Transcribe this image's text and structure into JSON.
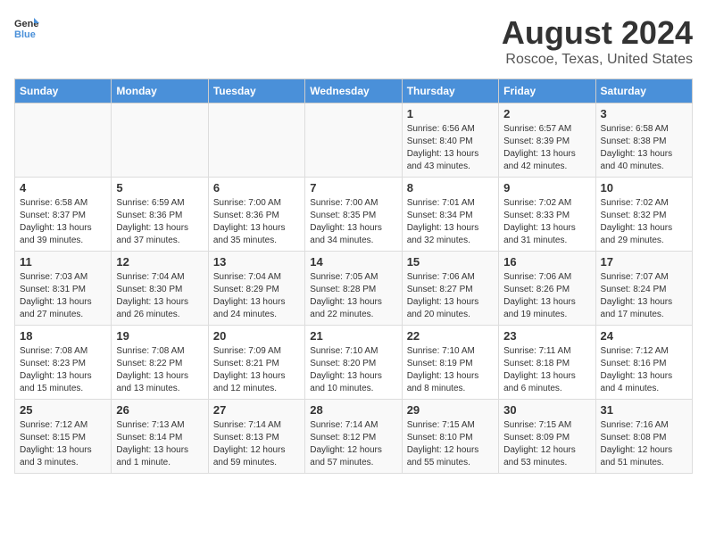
{
  "header": {
    "logo_general": "General",
    "logo_blue": "Blue",
    "title": "August 2024",
    "subtitle": "Roscoe, Texas, United States"
  },
  "days_of_week": [
    "Sunday",
    "Monday",
    "Tuesday",
    "Wednesday",
    "Thursday",
    "Friday",
    "Saturday"
  ],
  "weeks": [
    [
      {
        "day": "",
        "info": ""
      },
      {
        "day": "",
        "info": ""
      },
      {
        "day": "",
        "info": ""
      },
      {
        "day": "",
        "info": ""
      },
      {
        "day": "1",
        "info": "Sunrise: 6:56 AM\nSunset: 8:40 PM\nDaylight: 13 hours\nand 43 minutes."
      },
      {
        "day": "2",
        "info": "Sunrise: 6:57 AM\nSunset: 8:39 PM\nDaylight: 13 hours\nand 42 minutes."
      },
      {
        "day": "3",
        "info": "Sunrise: 6:58 AM\nSunset: 8:38 PM\nDaylight: 13 hours\nand 40 minutes."
      }
    ],
    [
      {
        "day": "4",
        "info": "Sunrise: 6:58 AM\nSunset: 8:37 PM\nDaylight: 13 hours\nand 39 minutes."
      },
      {
        "day": "5",
        "info": "Sunrise: 6:59 AM\nSunset: 8:36 PM\nDaylight: 13 hours\nand 37 minutes."
      },
      {
        "day": "6",
        "info": "Sunrise: 7:00 AM\nSunset: 8:36 PM\nDaylight: 13 hours\nand 35 minutes."
      },
      {
        "day": "7",
        "info": "Sunrise: 7:00 AM\nSunset: 8:35 PM\nDaylight: 13 hours\nand 34 minutes."
      },
      {
        "day": "8",
        "info": "Sunrise: 7:01 AM\nSunset: 8:34 PM\nDaylight: 13 hours\nand 32 minutes."
      },
      {
        "day": "9",
        "info": "Sunrise: 7:02 AM\nSunset: 8:33 PM\nDaylight: 13 hours\nand 31 minutes."
      },
      {
        "day": "10",
        "info": "Sunrise: 7:02 AM\nSunset: 8:32 PM\nDaylight: 13 hours\nand 29 minutes."
      }
    ],
    [
      {
        "day": "11",
        "info": "Sunrise: 7:03 AM\nSunset: 8:31 PM\nDaylight: 13 hours\nand 27 minutes."
      },
      {
        "day": "12",
        "info": "Sunrise: 7:04 AM\nSunset: 8:30 PM\nDaylight: 13 hours\nand 26 minutes."
      },
      {
        "day": "13",
        "info": "Sunrise: 7:04 AM\nSunset: 8:29 PM\nDaylight: 13 hours\nand 24 minutes."
      },
      {
        "day": "14",
        "info": "Sunrise: 7:05 AM\nSunset: 8:28 PM\nDaylight: 13 hours\nand 22 minutes."
      },
      {
        "day": "15",
        "info": "Sunrise: 7:06 AM\nSunset: 8:27 PM\nDaylight: 13 hours\nand 20 minutes."
      },
      {
        "day": "16",
        "info": "Sunrise: 7:06 AM\nSunset: 8:26 PM\nDaylight: 13 hours\nand 19 minutes."
      },
      {
        "day": "17",
        "info": "Sunrise: 7:07 AM\nSunset: 8:24 PM\nDaylight: 13 hours\nand 17 minutes."
      }
    ],
    [
      {
        "day": "18",
        "info": "Sunrise: 7:08 AM\nSunset: 8:23 PM\nDaylight: 13 hours\nand 15 minutes."
      },
      {
        "day": "19",
        "info": "Sunrise: 7:08 AM\nSunset: 8:22 PM\nDaylight: 13 hours\nand 13 minutes."
      },
      {
        "day": "20",
        "info": "Sunrise: 7:09 AM\nSunset: 8:21 PM\nDaylight: 13 hours\nand 12 minutes."
      },
      {
        "day": "21",
        "info": "Sunrise: 7:10 AM\nSunset: 8:20 PM\nDaylight: 13 hours\nand 10 minutes."
      },
      {
        "day": "22",
        "info": "Sunrise: 7:10 AM\nSunset: 8:19 PM\nDaylight: 13 hours\nand 8 minutes."
      },
      {
        "day": "23",
        "info": "Sunrise: 7:11 AM\nSunset: 8:18 PM\nDaylight: 13 hours\nand 6 minutes."
      },
      {
        "day": "24",
        "info": "Sunrise: 7:12 AM\nSunset: 8:16 PM\nDaylight: 13 hours\nand 4 minutes."
      }
    ],
    [
      {
        "day": "25",
        "info": "Sunrise: 7:12 AM\nSunset: 8:15 PM\nDaylight: 13 hours\nand 3 minutes."
      },
      {
        "day": "26",
        "info": "Sunrise: 7:13 AM\nSunset: 8:14 PM\nDaylight: 13 hours\nand 1 minute."
      },
      {
        "day": "27",
        "info": "Sunrise: 7:14 AM\nSunset: 8:13 PM\nDaylight: 12 hours\nand 59 minutes."
      },
      {
        "day": "28",
        "info": "Sunrise: 7:14 AM\nSunset: 8:12 PM\nDaylight: 12 hours\nand 57 minutes."
      },
      {
        "day": "29",
        "info": "Sunrise: 7:15 AM\nSunset: 8:10 PM\nDaylight: 12 hours\nand 55 minutes."
      },
      {
        "day": "30",
        "info": "Sunrise: 7:15 AM\nSunset: 8:09 PM\nDaylight: 12 hours\nand 53 minutes."
      },
      {
        "day": "31",
        "info": "Sunrise: 7:16 AM\nSunset: 8:08 PM\nDaylight: 12 hours\nand 51 minutes."
      }
    ]
  ]
}
